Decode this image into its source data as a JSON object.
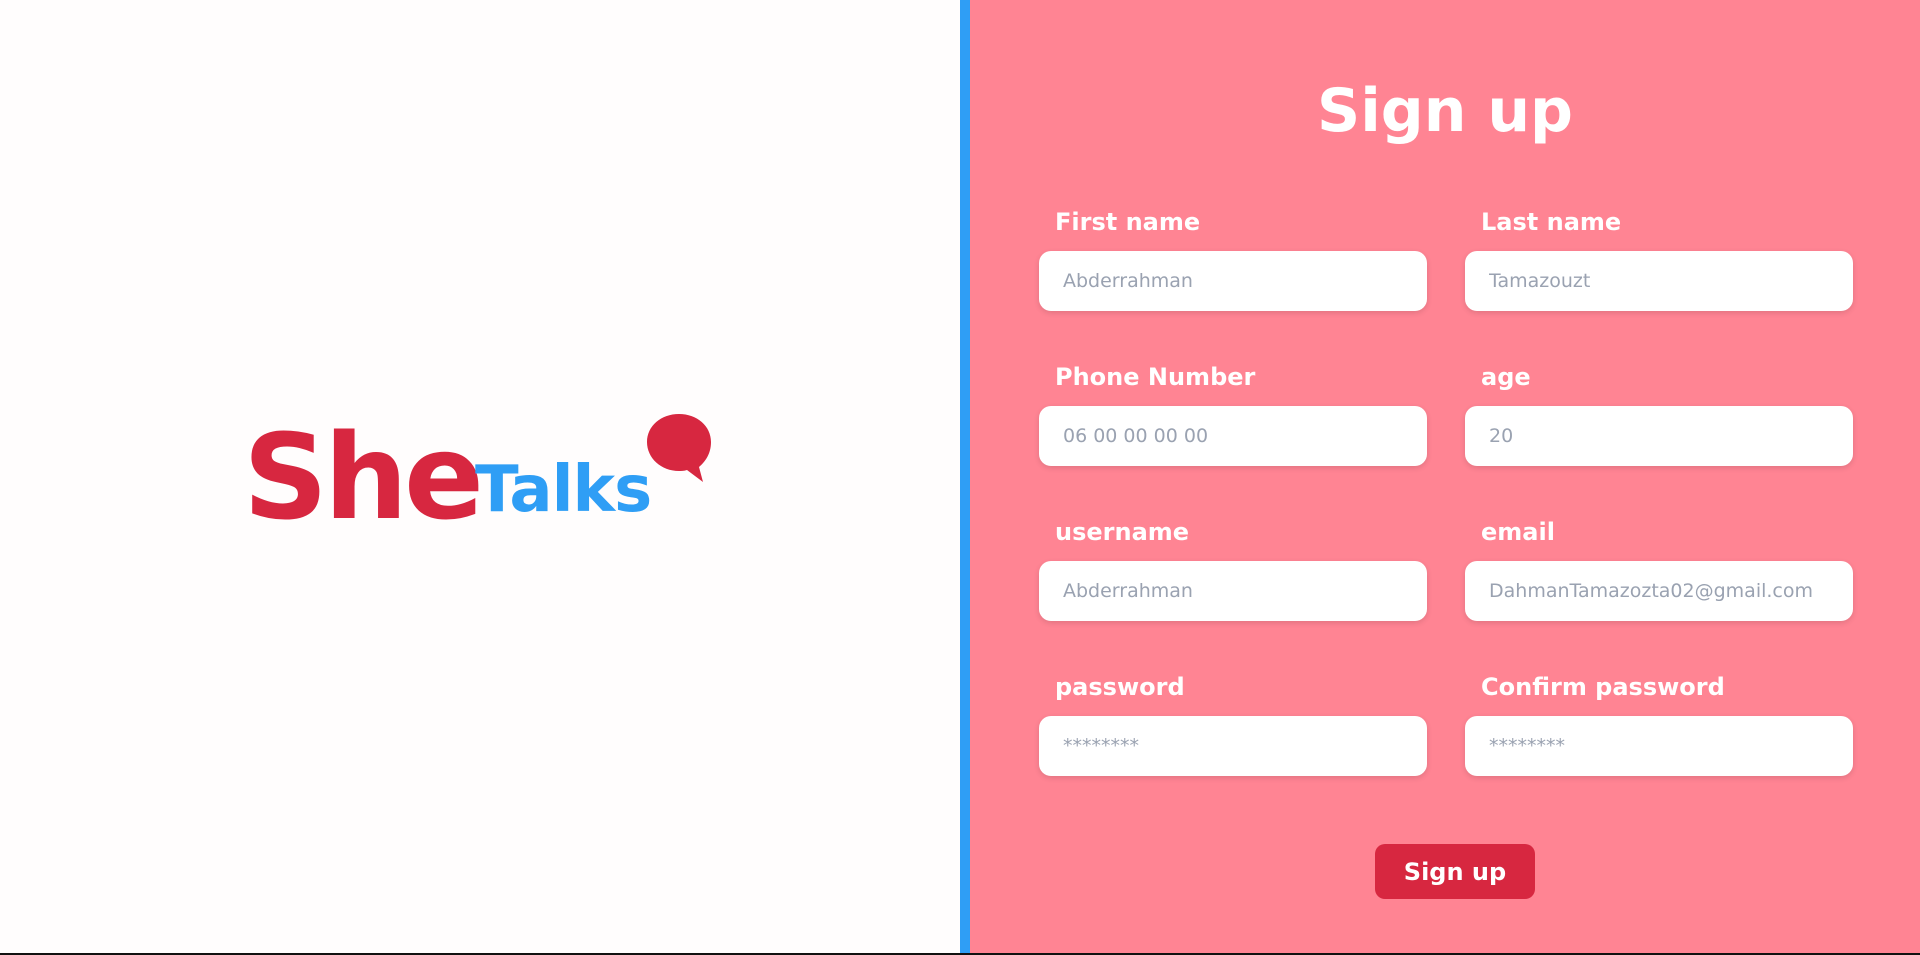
{
  "logo": {
    "part1": "She",
    "part2": "Talks",
    "primary_color": "#d72740",
    "secondary_color": "#2f9ef5",
    "icon": "speech-bubble-icon"
  },
  "form": {
    "title": "Sign up",
    "fields": {
      "first_name": {
        "label": "First name",
        "placeholder": "Abderrahman"
      },
      "last_name": {
        "label": "Last name",
        "placeholder": "Tamazouzt"
      },
      "phone": {
        "label": "Phone Number",
        "placeholder": "06 00 00 00 00"
      },
      "age": {
        "label": "age",
        "placeholder": "20"
      },
      "username": {
        "label": "username",
        "placeholder": "Abderrahman"
      },
      "email": {
        "label": "email",
        "placeholder": "DahmanTamazozta02@gmail.com"
      },
      "password": {
        "label": "password",
        "placeholder": "********"
      },
      "confirm_password": {
        "label": "Confirm password",
        "placeholder": "********"
      }
    },
    "submit_label": "Sign up"
  },
  "colors": {
    "panel_background": "#ff8493",
    "divider": "#2f9ef5",
    "button": "#d72740"
  }
}
